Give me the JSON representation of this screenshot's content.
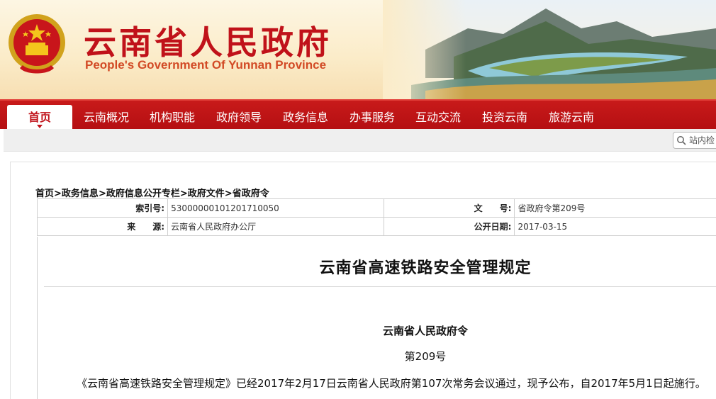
{
  "header": {
    "title": "云南省人民政府",
    "subtitle": "People's Government Of Yunnan Province"
  },
  "nav": {
    "items": [
      {
        "label": "首页",
        "active": true
      },
      {
        "label": "云南概况"
      },
      {
        "label": "机构职能"
      },
      {
        "label": "政府领导"
      },
      {
        "label": "政务信息"
      },
      {
        "label": "办事服务"
      },
      {
        "label": "互动交流"
      },
      {
        "label": "投资云南"
      },
      {
        "label": "旅游云南"
      }
    ]
  },
  "search": {
    "placeholder": "站内检"
  },
  "breadcrumb": {
    "items": [
      "首页",
      "政务信息",
      "政府信息公开专栏",
      "政府文件",
      "省政府令"
    ],
    "separator": ">"
  },
  "meta": {
    "index_label": "索引号:",
    "index_value": "53000000101201710050",
    "doc_label": "文　　号:",
    "doc_value": "省政府令第209号",
    "source_label": "来　　源:",
    "source_value": "云南省人民政府办公厅",
    "date_label": "公开日期:",
    "date_value": "2017-03-15"
  },
  "document": {
    "title": "云南省高速铁路安全管理规定",
    "order_name": "云南省人民政府令",
    "order_no": "第209号",
    "body": "《云南省高速铁路安全管理规定》已经2017年2月17日云南省人民政府第107次常务会议通过，现予公布，自2017年5月1日起施行。"
  },
  "colors": {
    "brand_red": "#c0121a",
    "nav_red": "#b50f12",
    "header_bg": "#fbecc9"
  }
}
